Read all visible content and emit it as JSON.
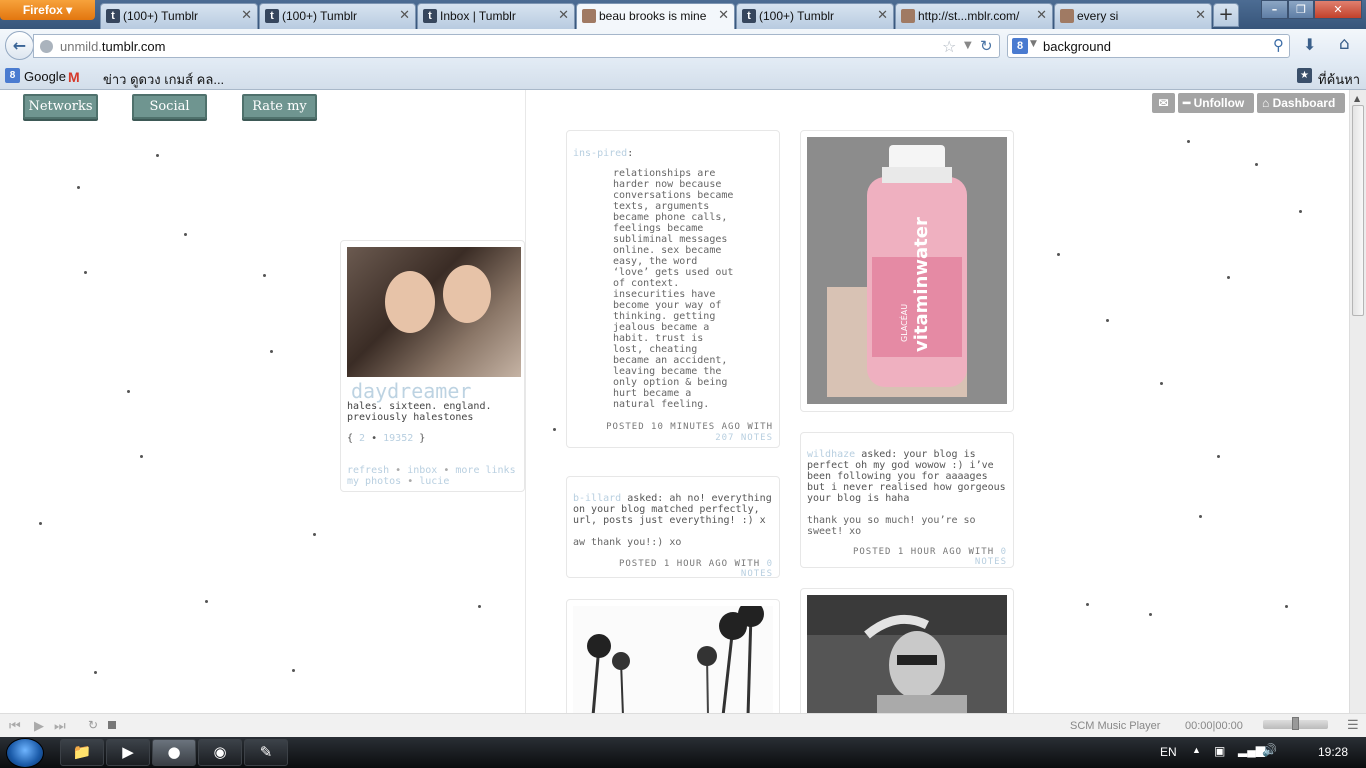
{
  "browser": {
    "menu_button": "Firefox ▾",
    "tabs": [
      {
        "title": "(100+) Tumblr",
        "icon": "tumblr-icon",
        "glyph": "t"
      },
      {
        "title": "(100+) Tumblr",
        "icon": "tumblr-icon",
        "glyph": "t"
      },
      {
        "title": "Inbox | Tumblr",
        "icon": "tumblr-icon",
        "glyph": "t"
      },
      {
        "title": "beau brooks is mine",
        "icon": "photo-favicon-icon",
        "glyph": "",
        "active": true
      },
      {
        "title": "(100+) Tumblr",
        "icon": "tumblr-icon",
        "glyph": "t"
      },
      {
        "title": "http://st...mblr.com/",
        "icon": "photo-favicon-icon",
        "glyph": ""
      },
      {
        "title": "every si",
        "icon": "photo-favicon-icon",
        "glyph": ""
      }
    ],
    "tab_close": "✕",
    "new_tab": "+",
    "window_controls": {
      "minimize": "–",
      "maximize": "❐",
      "close": "✕"
    },
    "url_prefix": "unmild.",
    "url_domain": "tumblr.com",
    "search_engine_glyph": "8",
    "search_value": "background",
    "bookmarks": {
      "google": "Google",
      "news": "ข่าว ดูดวง เกมส์ คล...",
      "search": "ที่ค้นหา"
    }
  },
  "page": {
    "nav_ribbons": [
      "Networks",
      "Social Medias",
      "Rate my blog!"
    ],
    "controls": {
      "message_icon": "✉",
      "unfollow": "Unfollow",
      "dashboard": "Dashboard"
    },
    "profile": {
      "name": "daydreamer",
      "bio": "hales. sixteen. england. previously halestones",
      "stats": {
        "open": "{ ",
        "followers": "2",
        "sep": " • ",
        "posts": "19352",
        "close": " }"
      },
      "links": [
        "refresh",
        "inbox",
        "more links",
        "my photos",
        "lucie"
      ]
    },
    "posts": {
      "quote": {
        "source": "ins-pired",
        "text": "relationships are harder now because conversations became texts, arguments became phone calls, feelings became subliminal messages online. sex became easy, the word ‘love’ gets used out of context. insecurities have become your way of thinking. getting jealous became a habit. trust is lost, cheating became an accident, leaving became the only option & being hurt became a natural feeling.",
        "meta_prefix": "POSTED 10 MINUTES AGO WITH",
        "notes": "207 NOTES"
      },
      "ask1": {
        "asker": "b-illard",
        "verb": "asked:",
        "question": "ah no! everything on your blog matched perfectly, url, posts just everything! :) x",
        "answer": "aw thank you!:) xo",
        "meta_prefix": "POSTED 1 HOUR AGO WITH",
        "notes": "0 NOTES"
      },
      "ask2": {
        "asker": "wildhaze",
        "verb": "asked:",
        "question": "your blog is perfect oh my god wowow :) i’ve been following you for aaaages but i never realised how gorgeous your blog is haha",
        "answer": "thank you so much! you’re so sweet! xo",
        "meta_prefix": "POSTED 1 HOUR AGO WITH",
        "notes": "0 NOTES"
      },
      "photo_bottle_label": "vitaminwater",
      "photo_bottle_brand": "GLACÉAU"
    }
  },
  "music_player": {
    "title": "SCM Music Player",
    "time": "00:00|00:00"
  },
  "taskbar": {
    "language": "EN",
    "clock": "19:28"
  }
}
